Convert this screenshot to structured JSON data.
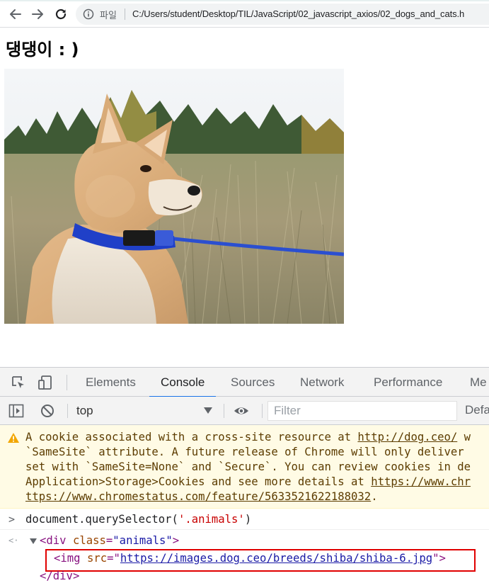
{
  "browser": {
    "omnibox": {
      "scheme_label": "파일",
      "url": "C:/Users/student/Desktop/TIL/JavaScript/02_javascript_axios/02_dogs_and_cats.h"
    },
    "icons": [
      "back-arrow-icon",
      "forward-arrow-icon",
      "reload-icon",
      "info-icon"
    ]
  },
  "page": {
    "heading": "댕댕이 : )",
    "image": {
      "subject": "shiba-inu-puppy-photo"
    }
  },
  "devtools": {
    "tabs": [
      {
        "label": "Elements"
      },
      {
        "label": "Console",
        "active": true
      },
      {
        "label": "Sources"
      },
      {
        "label": "Network"
      },
      {
        "label": "Performance"
      },
      {
        "label": "Me"
      }
    ],
    "toolbar": {
      "context": "top",
      "filter_placeholder": "Filter",
      "levels": "Defa"
    },
    "warning": {
      "lines": [
        {
          "prefix": "A cookie associated with a cross-site resource at ",
          "link": "http://dog.ceo/",
          "suffix": " w"
        },
        {
          "text": "`SameSite` attribute. A future release of Chrome will only deliver"
        },
        {
          "text": "set with `SameSite=None` and `Secure`. You can review cookies in de"
        },
        {
          "prefix": "Application>Storage>Cookies and see more details at ",
          "link": "https://www.chr"
        },
        {
          "link": "ttps://www.chromestatus.com/feature/5633521622188032",
          "suffix": "."
        }
      ]
    },
    "command": {
      "prefix": "document.querySelector(",
      "arg": "'.animals'",
      "suffix": ")"
    },
    "result": {
      "open_tag_name": "div",
      "attr_name": "class",
      "attr_value": "\"animals\"",
      "img_tag": "img",
      "img_attr": "src",
      "img_src": "https://images.dog.ceo/breeds/shiba/shiba-6.jpg",
      "close_tag": "</div>"
    },
    "colors": {
      "accent": "#1a73e8",
      "warning_bg": "#fffbe5",
      "highlight": "#e00000"
    }
  }
}
